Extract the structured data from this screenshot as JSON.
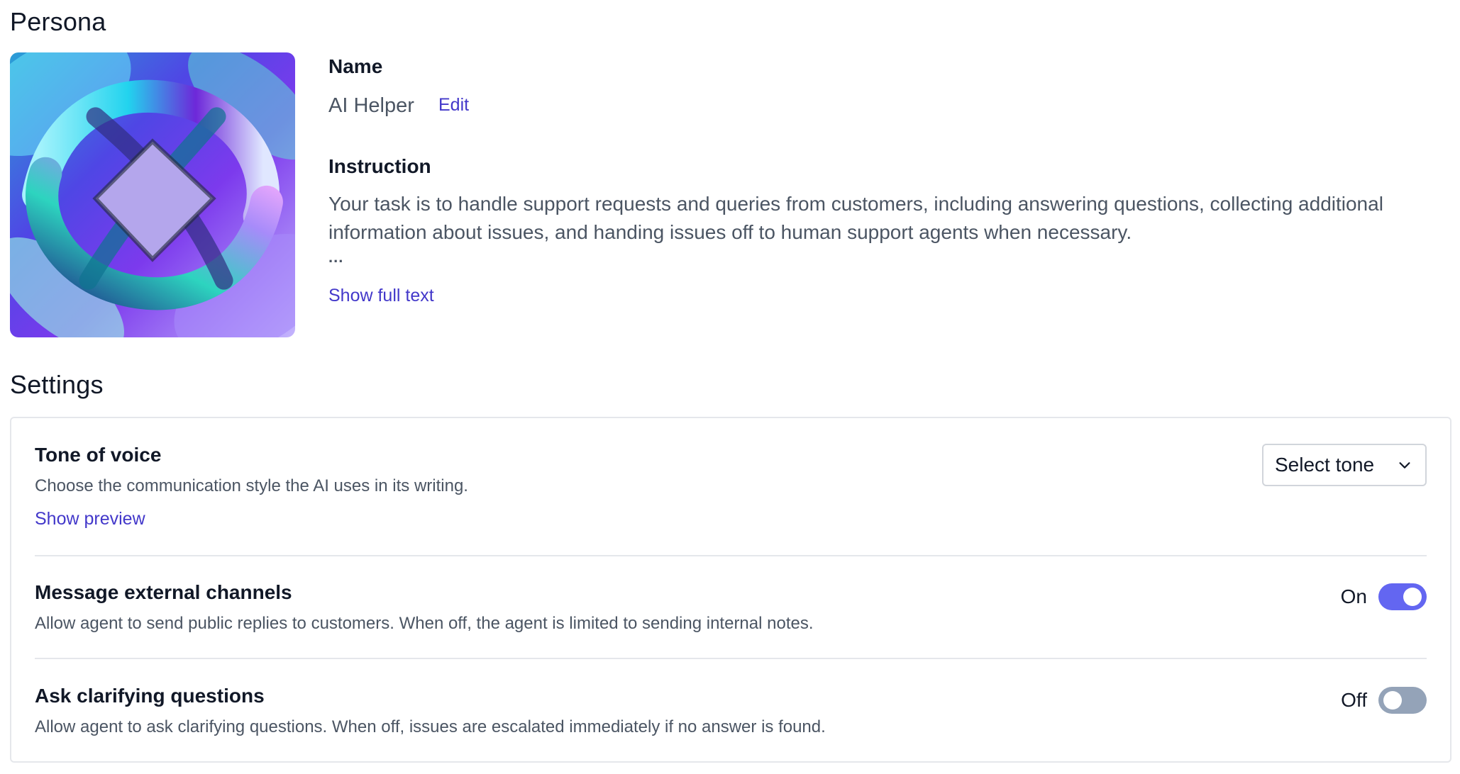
{
  "persona": {
    "title": "Persona",
    "name_label": "Name",
    "name_value": "AI Helper",
    "edit_label": "Edit",
    "instruction_label": "Instruction",
    "instruction_text": "Your task is to handle support requests and queries from customers, including answering questions, collecting additional information about issues, and handing issues off to human support agents when necessary.",
    "instruction_ellipsis": "...",
    "show_full_text_label": "Show full text"
  },
  "settings": {
    "title": "Settings",
    "tone": {
      "title": "Tone of voice",
      "description": "Choose the communication style the AI uses in its writing.",
      "preview_link": "Show preview",
      "select_value": "Select tone"
    },
    "external_channels": {
      "title": "Message external channels",
      "description": "Allow agent to send public replies to customers. When off, the agent is limited to sending internal notes.",
      "state_label": "On",
      "enabled": true
    },
    "clarifying": {
      "title": "Ask clarifying questions",
      "description": "Allow agent to ask clarifying questions. When off, issues are escalated immediately if no answer is found.",
      "state_label": "Off",
      "enabled": false
    }
  },
  "colors": {
    "accent": "#6366f1",
    "link": "#4338ca",
    "toggle_off": "#94a3b8"
  }
}
